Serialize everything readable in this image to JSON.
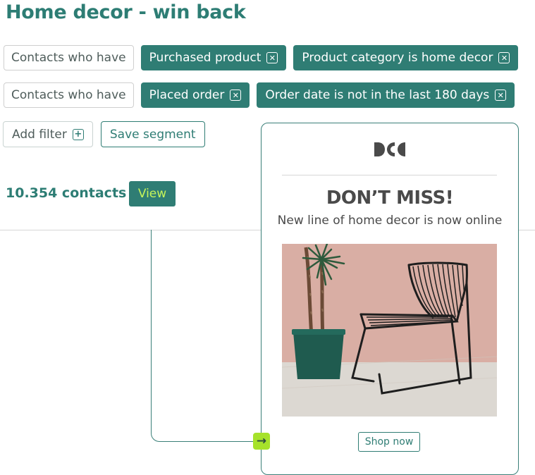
{
  "page": {
    "title": "Home decor - win back"
  },
  "filters": {
    "row1": {
      "label": "Contacts who have",
      "chips": [
        "Purchased product",
        "Product category is home decor"
      ]
    },
    "row2": {
      "label": "Contacts who have",
      "chips": [
        "Placed order",
        "Order date is not in the last 180 days"
      ]
    }
  },
  "actions": {
    "add_filter": "Add filter",
    "save_segment": "Save segment"
  },
  "summary": {
    "contacts": "10.354 contacts",
    "view": "View"
  },
  "email_preview": {
    "headline": "DON’T MISS!",
    "subline": "New line of home decor is now online",
    "shop_now": "Shop now"
  },
  "icons": {
    "remove": "close-square-icon",
    "add": "plus-square-icon",
    "arrow": "arrow-right-icon"
  },
  "colors": {
    "brand": "#2f7d74",
    "accent": "#a6e22b",
    "button_text_accent": "#c6f45a"
  }
}
